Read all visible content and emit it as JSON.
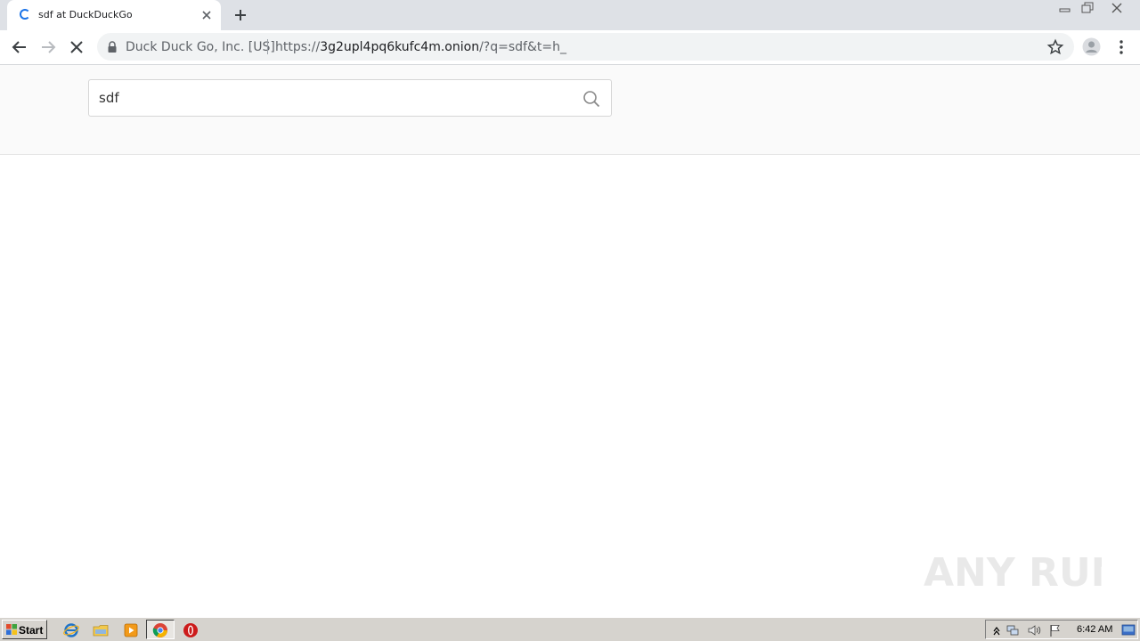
{
  "browser": {
    "tab": {
      "title": "sdf at DuckDuckGo"
    },
    "omnibox": {
      "site_name": "Duck Duck Go, Inc. [US]",
      "url_scheme": "https://",
      "url_host": "3g2upl4pq6kufc4m.onion",
      "url_rest": "/?q=sdf&t=h_"
    }
  },
  "page": {
    "search": {
      "value": "sdf"
    }
  },
  "watermark": {
    "text": "ANY RUN"
  },
  "taskbar": {
    "start_label": "Start",
    "clock": "6:42 AM"
  },
  "colors": {
    "accent": "#1a73e8",
    "tab_strip": "#dee1e6",
    "taskbar": "#d6d3ce"
  }
}
